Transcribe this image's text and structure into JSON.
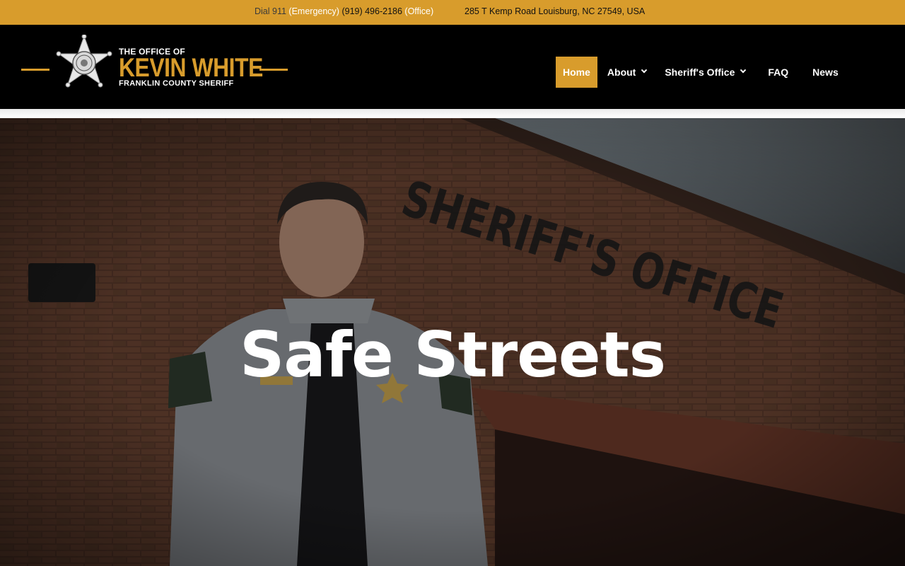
{
  "topbar": {
    "dial": "Dial 911",
    "emergency": "(Emergency)",
    "phone": "(919) 496-2186",
    "office": "(Office)",
    "address": "285 T Kemp Road Louisburg, NC 27549, USA"
  },
  "logo": {
    "line1": "THE OFFICE OF",
    "line2": "KEVIN WHITE",
    "line3": "FRANKLIN COUNTY SHERIFF",
    "badge_icon": "sheriff-star-badge-icon"
  },
  "nav": {
    "items": [
      {
        "label": "Home",
        "active": true
      },
      {
        "label": "About",
        "dropdown": true
      },
      {
        "label": "Sheriff's Office",
        "dropdown": true
      },
      {
        "label": "FAQ"
      },
      {
        "label": "News"
      }
    ]
  },
  "hero": {
    "title": "Safe Streets",
    "building_sign": "SHERIFF'S OFFICE"
  },
  "colors": {
    "accent": "#d89c2c",
    "header_bg": "#000000",
    "text_light": "#ffffff"
  }
}
